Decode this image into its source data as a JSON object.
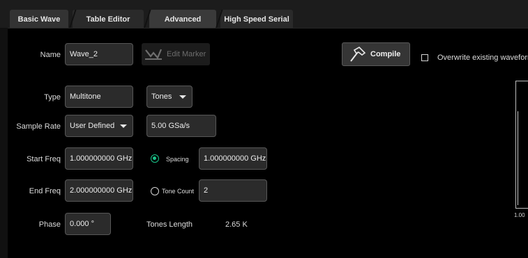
{
  "tabs": [
    {
      "label": "Basic Wave"
    },
    {
      "label": "Table Editor"
    },
    {
      "label": "Advanced"
    },
    {
      "label": "High Speed Serial"
    }
  ],
  "form": {
    "name_label": "Name",
    "name_value": "Wave_2",
    "edit_marker_label": "Edit Marker",
    "compile_label": "Compile",
    "overwrite_label": "Overwrite existing waveform",
    "type_label": "Type",
    "type_value": "Multitone",
    "tones_value": "Tones",
    "sample_rate_label": "Sample Rate",
    "sample_rate_value": "User Defined",
    "sample_rate_rate": "5.00 GSa/s",
    "start_freq_label": "Start Freq",
    "start_freq_value": "1.000000000 GHz",
    "spacing_label": "Spacing",
    "spacing_value": "1.000000000 GHz",
    "end_freq_label": "End Freq",
    "end_freq_value": "2.000000000 GHz",
    "tone_count_label": "Tone Count",
    "tone_count_value": "2",
    "phase_label": "Phase",
    "phase_value": "0.000 °",
    "tones_length_label": "Tones Length",
    "tones_length_value": "2.65 K"
  },
  "preview": {
    "axis_label": "1.00"
  },
  "colors": {
    "accent": "#19c58a",
    "panel": "#000000",
    "field": "#2b2b2b"
  },
  "icons": {
    "edit_marker": "pen-marker-icon",
    "compile": "hammer-icon"
  }
}
